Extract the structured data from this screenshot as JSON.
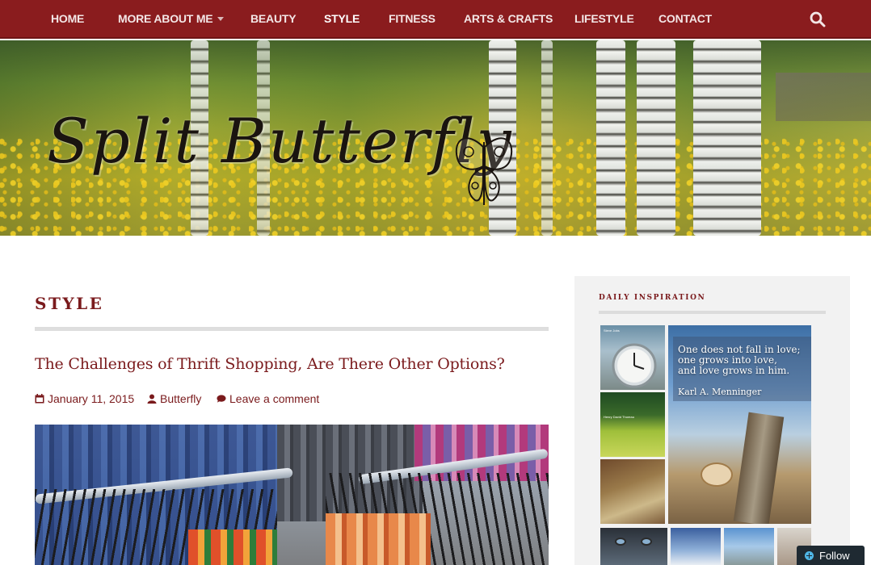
{
  "nav": {
    "items": [
      {
        "label": "HOME"
      },
      {
        "label": "MORE ABOUT ME"
      },
      {
        "label": "BEAUTY"
      },
      {
        "label": "STYLE"
      },
      {
        "label": "FITNESS"
      },
      {
        "label": "ARTS & CRAFTS"
      },
      {
        "label": "LIFESTYLE"
      },
      {
        "label": "CONTACT"
      }
    ],
    "active": "STYLE",
    "bg_color": "#8a1c1e",
    "search_icon": "search-icon"
  },
  "header": {
    "logo_text": "Split Butterfly",
    "logo_icon": "butterfly-icon"
  },
  "main": {
    "section_title": "STYLE",
    "post": {
      "title": "The Challenges of Thrift Shopping, Are There Other Options?",
      "date": "January 11, 2015",
      "author": "Butterfly",
      "comments": "Leave a comment"
    },
    "accent_color": "#7a1a1c"
  },
  "sidebar": {
    "widget_title": "DAILY INSPIRATION",
    "featured_quote": {
      "lines": [
        "One does not fall in love;",
        "one grows into love,",
        "and love grows in him."
      ],
      "author": "Karl A. Menninger"
    },
    "thumb_captions": {
      "clock": "Steve Jobs",
      "field": "Henry David Thoreau"
    }
  },
  "follow": {
    "label": "Follow"
  }
}
